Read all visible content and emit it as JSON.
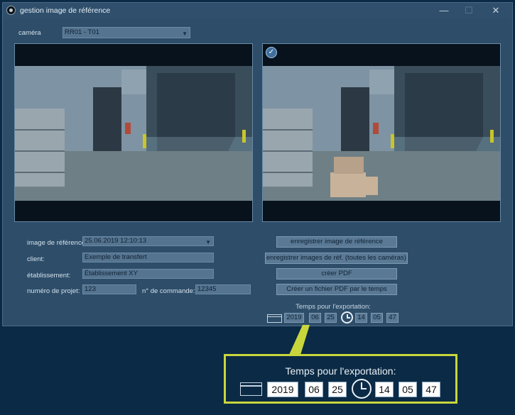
{
  "window": {
    "title": "gestion image de référence",
    "minimize": "—",
    "maximize": "☐",
    "close": "✕"
  },
  "camera": {
    "label": "caméra",
    "value": "RR01 - T01"
  },
  "form": {
    "reference_image_label": "image de référence:",
    "reference_image_value": "25.06.2019 12:10:13",
    "client_label": "client:",
    "client_value": "Exemple de transfert",
    "site_label": "établissement:",
    "site_value": "Établissement XY",
    "project_label": "numéro de projet:",
    "project_value": "123",
    "order_label": "n° de commande:",
    "order_value": "12345"
  },
  "buttons": {
    "save_reference": "enregistrer image de référence",
    "save_all": "enregistrer images de réf. (toutes les caméras)",
    "create_pdf": "créer PDF",
    "create_pdf_time": "Créer un fichier PDF par le temps"
  },
  "export": {
    "title": "Temps pour l'exportation:",
    "year": "2019",
    "month": "06",
    "day": "25",
    "hour": "14",
    "minute": "05",
    "second": "47"
  },
  "icons": {
    "calendar": "calendar-icon",
    "clock": "clock-icon",
    "checkmark": "checkmark-icon",
    "app": "app-icon"
  },
  "colors": {
    "desktop": "#0b2a45",
    "window": "#2d4d69",
    "callout": "#c8d63c"
  }
}
